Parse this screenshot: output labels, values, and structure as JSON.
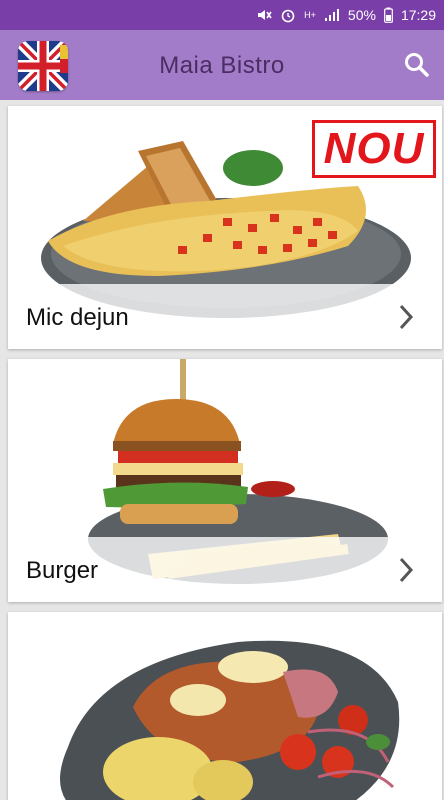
{
  "status_bar": {
    "battery": "50%",
    "time": "17:29",
    "network": "H+"
  },
  "app": {
    "title": "Maia Bistro",
    "language_icon": "uk-flag-icon",
    "search_icon": "search-icon"
  },
  "categories": [
    {
      "name": "Mic dejun",
      "badge": "NOU"
    },
    {
      "name": "Burger"
    },
    {
      "name": ""
    }
  ],
  "colors": {
    "status_bar": "#7a3ea8",
    "toolbar": "#a37cc9",
    "badge": "#e2161b"
  }
}
